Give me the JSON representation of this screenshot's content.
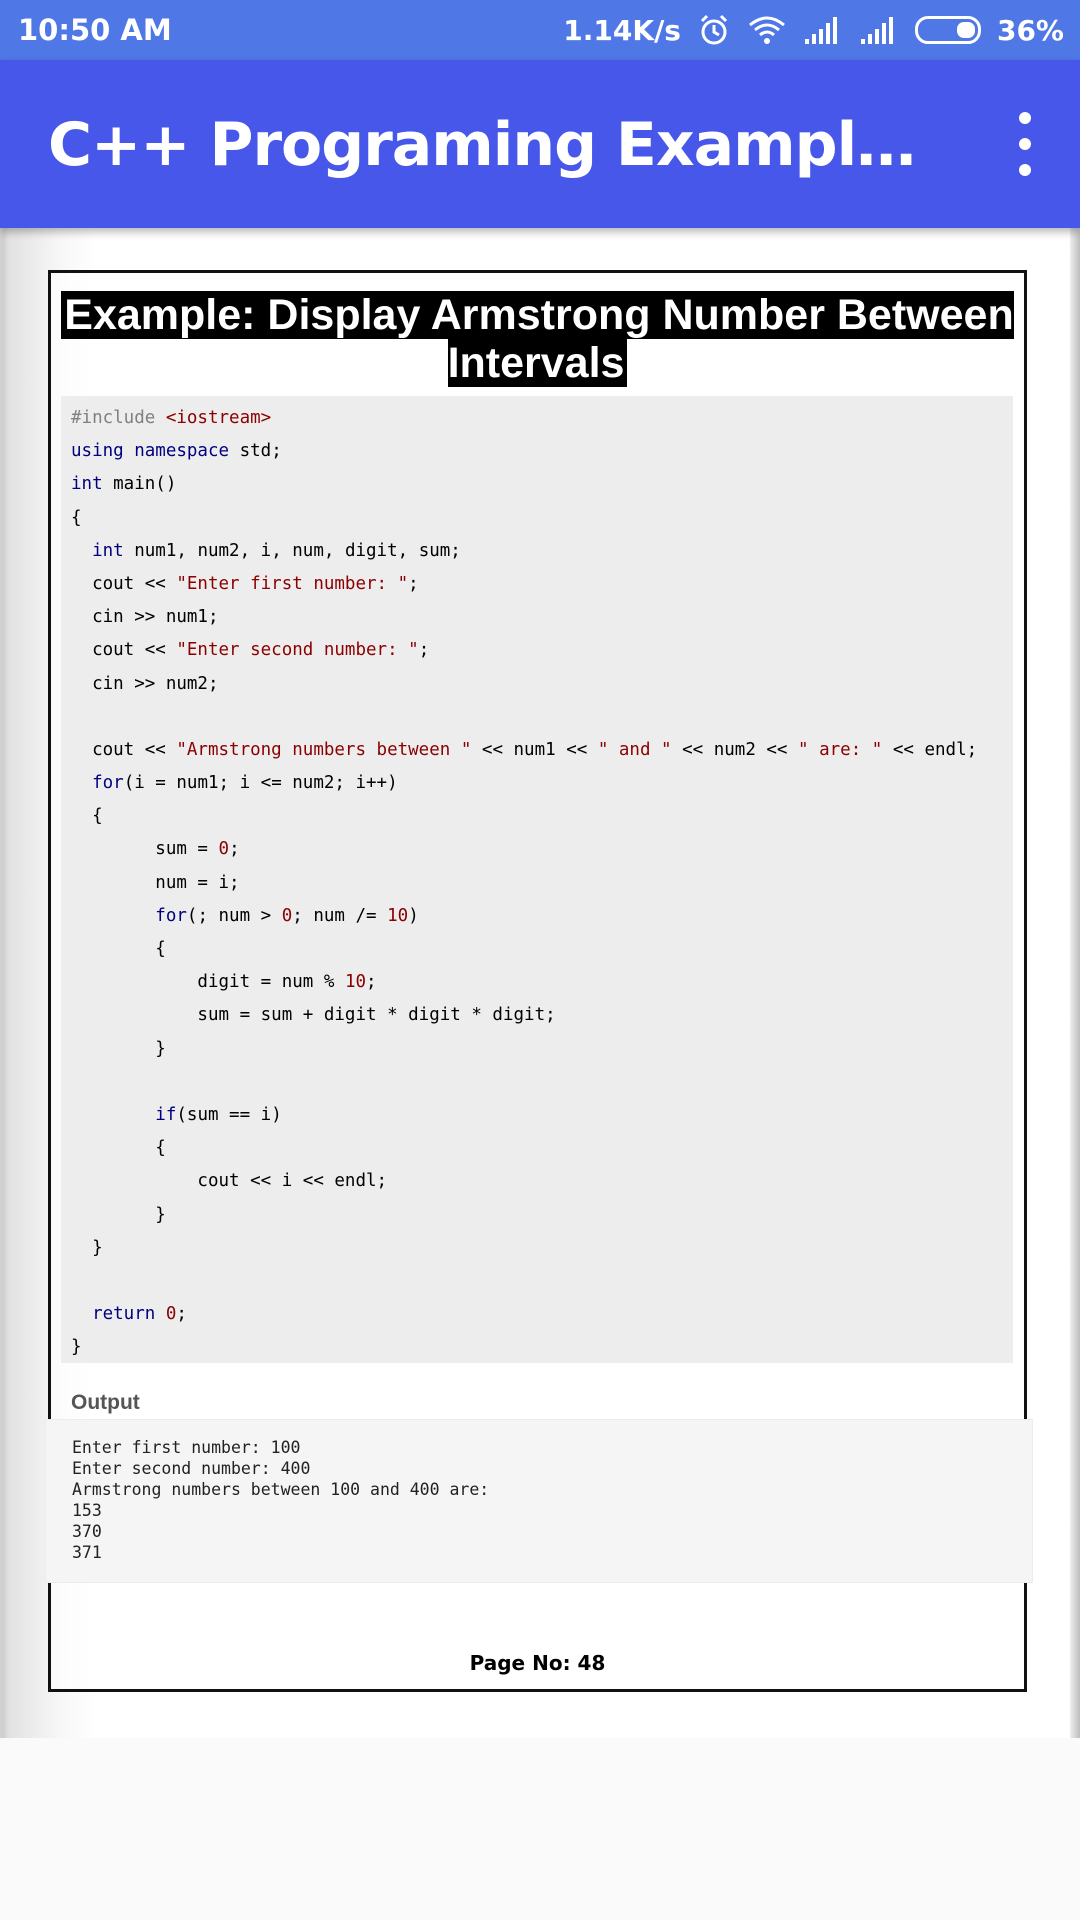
{
  "status": {
    "time": "10:50 AM",
    "speed": "1.14K/s",
    "battery": "36%"
  },
  "appbar": {
    "title": "C++ Programing Examples Ebo…"
  },
  "page": {
    "title": "Example: Display Armstrong Number Between Intervals",
    "code_lines": [
      [
        {
          "t": "#include ",
          "c": "pp"
        },
        {
          "t": "<iostream>",
          "c": "str"
        }
      ],
      [
        {
          "t": "using namespace",
          "c": "kw"
        },
        {
          "t": " std;",
          "c": ""
        }
      ],
      [
        {
          "t": "int",
          "c": "kw"
        },
        {
          "t": " main()",
          "c": ""
        }
      ],
      [
        {
          "t": "{",
          "c": ""
        }
      ],
      [
        {
          "t": "  ",
          "c": ""
        },
        {
          "t": "int",
          "c": "kw"
        },
        {
          "t": " num1, num2, i, num, digit, sum;",
          "c": ""
        }
      ],
      [
        {
          "t": "  cout << ",
          "c": ""
        },
        {
          "t": "\"Enter first number: \"",
          "c": "str"
        },
        {
          "t": ";",
          "c": ""
        }
      ],
      [
        {
          "t": "  cin >> num1;",
          "c": ""
        }
      ],
      [
        {
          "t": "  cout << ",
          "c": ""
        },
        {
          "t": "\"Enter second number: \"",
          "c": "str"
        },
        {
          "t": ";",
          "c": ""
        }
      ],
      [
        {
          "t": "  cin >> num2;",
          "c": ""
        }
      ],
      [
        {
          "t": "",
          "c": ""
        }
      ],
      [
        {
          "t": "  cout << ",
          "c": ""
        },
        {
          "t": "\"Armstrong numbers between \"",
          "c": "str"
        },
        {
          "t": " << num1 << ",
          "c": ""
        },
        {
          "t": "\" and \"",
          "c": "str"
        },
        {
          "t": " << num2 << ",
          "c": ""
        },
        {
          "t": "\" are: \"",
          "c": "str"
        },
        {
          "t": " << endl;",
          "c": ""
        }
      ],
      [
        {
          "t": "  ",
          "c": ""
        },
        {
          "t": "for",
          "c": "kw"
        },
        {
          "t": "(i = num1; i <= num2; i++)",
          "c": ""
        }
      ],
      [
        {
          "t": "  {",
          "c": ""
        }
      ],
      [
        {
          "t": "        sum = ",
          "c": ""
        },
        {
          "t": "0",
          "c": "num"
        },
        {
          "t": ";",
          "c": ""
        }
      ],
      [
        {
          "t": "        num = i;",
          "c": ""
        }
      ],
      [
        {
          "t": "        ",
          "c": ""
        },
        {
          "t": "for",
          "c": "kw"
        },
        {
          "t": "(; num > ",
          "c": ""
        },
        {
          "t": "0",
          "c": "num"
        },
        {
          "t": "; num /= ",
          "c": ""
        },
        {
          "t": "10",
          "c": "num"
        },
        {
          "t": ")",
          "c": ""
        }
      ],
      [
        {
          "t": "        {",
          "c": ""
        }
      ],
      [
        {
          "t": "            digit = num % ",
          "c": ""
        },
        {
          "t": "10",
          "c": "num"
        },
        {
          "t": ";",
          "c": ""
        }
      ],
      [
        {
          "t": "            sum = sum + digit * digit * digit;",
          "c": ""
        }
      ],
      [
        {
          "t": "        }",
          "c": ""
        }
      ],
      [
        {
          "t": "",
          "c": ""
        }
      ],
      [
        {
          "t": "        ",
          "c": ""
        },
        {
          "t": "if",
          "c": "kw"
        },
        {
          "t": "(sum == i)",
          "c": ""
        }
      ],
      [
        {
          "t": "        {",
          "c": ""
        }
      ],
      [
        {
          "t": "            cout << i << endl;",
          "c": ""
        }
      ],
      [
        {
          "t": "        }",
          "c": ""
        }
      ],
      [
        {
          "t": "  }",
          "c": ""
        }
      ],
      [
        {
          "t": "",
          "c": ""
        }
      ],
      [
        {
          "t": "  ",
          "c": ""
        },
        {
          "t": "return",
          "c": "kw"
        },
        {
          "t": " ",
          "c": ""
        },
        {
          "t": "0",
          "c": "num"
        },
        {
          "t": ";",
          "c": ""
        }
      ],
      [
        {
          "t": "}",
          "c": ""
        }
      ]
    ],
    "output_label": "Output",
    "output_lines": [
      "Enter first number: 100",
      "Enter second number: 400",
      "Armstrong numbers between 100 and 400 are:",
      "153",
      "370",
      "371"
    ],
    "page_number": "Page No: 48"
  }
}
